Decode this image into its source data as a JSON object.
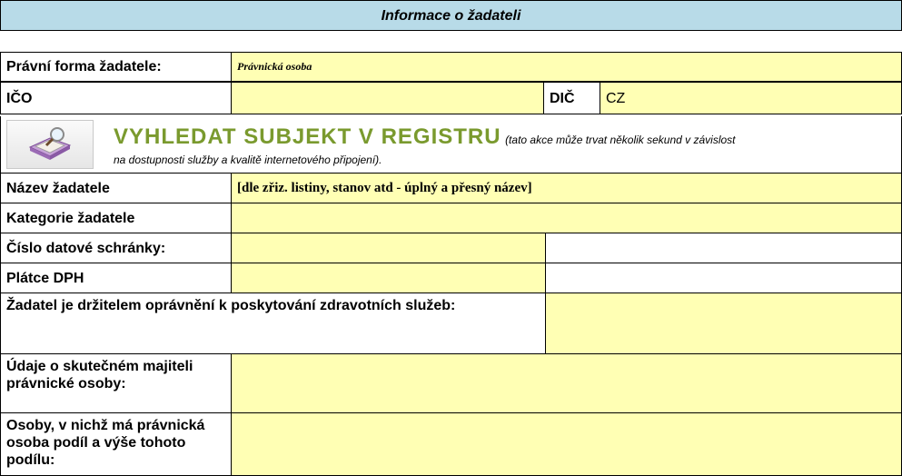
{
  "section_header": "Informace o žadateli",
  "legal_form": {
    "label": "Právní forma žadatele:",
    "value": "Právnická osoba"
  },
  "ico": {
    "label": "IČO",
    "value": ""
  },
  "dic": {
    "label": "DIČ",
    "value": "CZ"
  },
  "registry_search": {
    "icon": "book-search-icon",
    "title": "VYHLEDAT SUBJEKT V REGISTRU",
    "note_line1": "(tato akce může trvat několik sekund v závislost",
    "note_line2": "na dostupnosti služby a kvalitě internetového připojení)."
  },
  "fields": {
    "name": {
      "label": "Název žadatele",
      "value": "[dle zřiz. listiny, stanov atd - úplný a přesný název]"
    },
    "category": {
      "label": "Kategorie žadatele",
      "value": ""
    },
    "data_box": {
      "label": "Číslo datové schránky:",
      "value": ""
    },
    "vat_payer": {
      "label": "Plátce DPH",
      "value": ""
    },
    "health_services": {
      "label": "Žadatel je držitelem oprávnění k poskytování zdravotních služeb:",
      "value": ""
    },
    "beneficial_owner": {
      "label": "Údaje o skutečném majiteli právnické osoby:",
      "value": ""
    },
    "shareholdings": {
      "label": "Osoby, v nichž má právnická osoba podíl a výše tohoto podílu:",
      "value": ""
    }
  },
  "colors": {
    "header_bg": "#b8dbe8",
    "input_bg": "#ffffb4",
    "search_title": "#7a9a2e"
  }
}
